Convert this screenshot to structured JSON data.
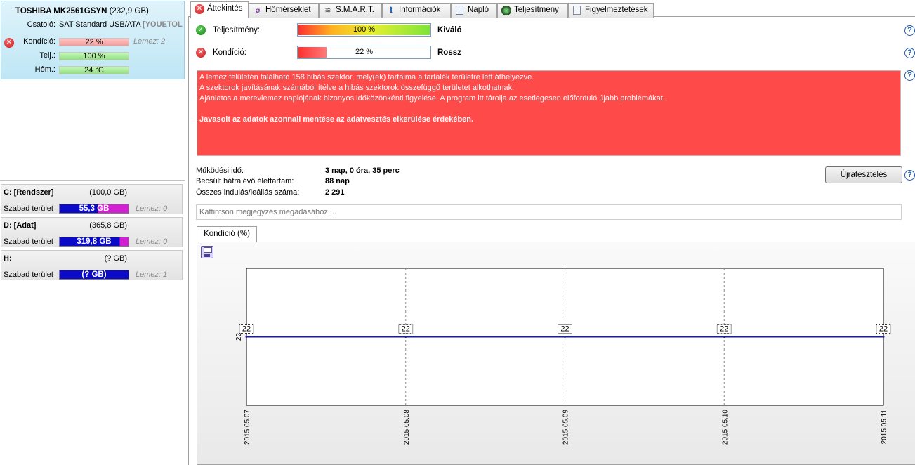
{
  "disk": {
    "model": "TOSHIBA MK2561GSYN",
    "size": "(232,9 GB)",
    "connector_label": "Csatoló:",
    "connector_value": "SAT Standard USB/ATA",
    "connector_extra": "[YOUETOL",
    "condition_label": "Kondíció:",
    "condition_value": "22 %",
    "condition_fraction": 0.22,
    "perf_label": "Telj.:",
    "perf_value": "100 %",
    "temp_label": "Hőm.:",
    "temp_value": "24 °C",
    "disk_ref": "Lemez: 2"
  },
  "partitions": [
    {
      "name": "C: [Rendszer]",
      "size": "(100,0 GB)",
      "free_label": "Szabad terület",
      "free_value": "55,3 GB",
      "free_fraction": 0.55,
      "disk_ref": "Lemez: 0"
    },
    {
      "name": "D: [Adat]",
      "size": "(365,8 GB)",
      "free_label": "Szabad terület",
      "free_value": "319,8 GB",
      "free_fraction": 0.874,
      "disk_ref": "Lemez: 0"
    },
    {
      "name": "H:",
      "size": "(? GB)",
      "free_label": "Szabad terület",
      "free_value": "(? GB)",
      "free_fraction": 1.0,
      "disk_ref": "Lemez: 1"
    }
  ],
  "tabs": [
    {
      "label": "Áttekintés",
      "icon": "error-icon"
    },
    {
      "label": "Hőmérséklet",
      "icon": "thermometer-icon"
    },
    {
      "label": "S.M.A.R.T.",
      "icon": "smart-icon"
    },
    {
      "label": "Információk",
      "icon": "info-icon"
    },
    {
      "label": "Napló",
      "icon": "log-icon"
    },
    {
      "label": "Teljesítmény",
      "icon": "performance-icon"
    },
    {
      "label": "Figyelmeztetések",
      "icon": "warnings-icon"
    }
  ],
  "overview": {
    "performance_label": "Teljesítmény:",
    "performance_value": "100 %",
    "performance_fraction": 1.0,
    "performance_status": "Kiváló",
    "condition_label": "Kondíció:",
    "condition_value": "22 %",
    "condition_fraction": 0.22,
    "condition_status": "Rossz",
    "alert_lines": [
      "A lemez felületén található 158 hibás szektor, mely(ek) tartalma a tartalék területre lett áthelyezve.",
      "A szektorok javításának számából ítélve a hibás szektorok összefüggő területet alkothatnak.",
      "Ajánlatos a merevlemez naplójának bizonyos időközönkénti figyelése. A program itt tárolja az esetlegesen előforduló újabb problémákat."
    ],
    "alert_strong": "Javasolt az adatok azonnali mentése az adatvesztés elkerülése érdekében.",
    "uptime_label": "Működési idő:",
    "uptime_value": "3 nap, 0 óra, 35 perc",
    "lifetime_label": "Becsült hátralévő élettartam:",
    "lifetime_value": "88 nap",
    "startstop_label": "Összes indulás/leállás száma:",
    "startstop_value": "2 291",
    "retest_label": "Újratesztelés",
    "note_placeholder": "Kattintson megjegyzés megadásához ...",
    "help_glyph": "?"
  },
  "chart_tab_label": "Kondíció  (%)",
  "chart_data": {
    "type": "line",
    "x": [
      "2015.05.07",
      "2015.05.08",
      "2015.05.09",
      "2015.05.10",
      "2015.05.11"
    ],
    "series": [
      {
        "values": [
          22,
          22,
          22,
          22,
          22
        ]
      }
    ],
    "data_labels": [
      "22",
      "22",
      "22",
      "22",
      "22"
    ],
    "ytick_labels": [
      "22"
    ],
    "ylim": [
      21,
      23
    ],
    "grid": "vertical-dashed",
    "line_color": "#1a1aa8"
  },
  "colors": {
    "alert_bg": "#ff4a4a",
    "partition_bar": "#0a0ac8",
    "partition_used": "#d21fd2"
  }
}
